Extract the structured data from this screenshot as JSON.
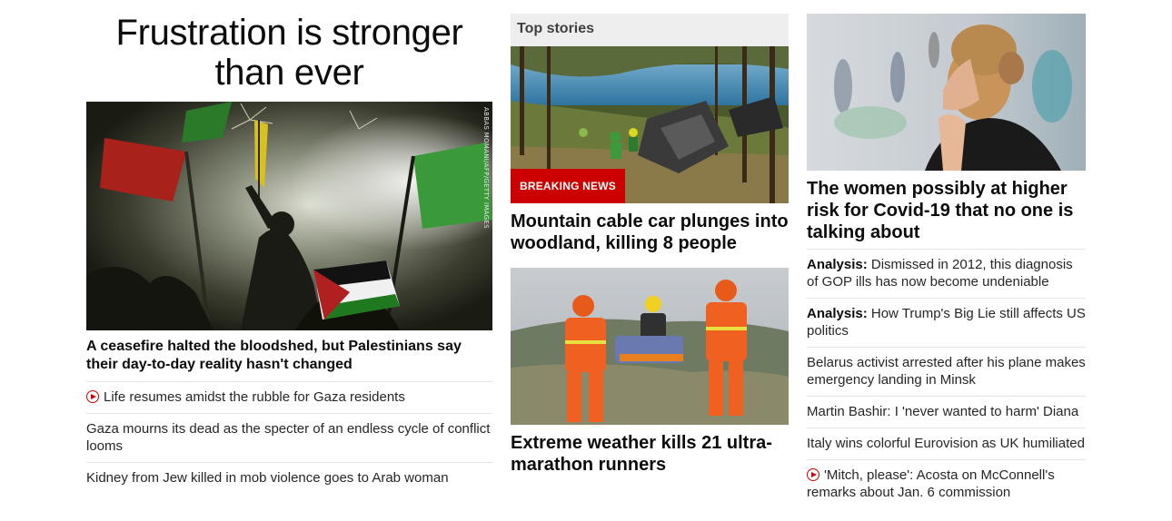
{
  "left": {
    "title": "Frustration is stronger than ever",
    "image_credit": "ABBAS MOMANI/AFP/GETTY IMAGES",
    "headline": "A ceasefire halted the bloodshed, but Palestinians say their day-to-day reality hasn't changed",
    "stories": [
      {
        "text": "Life resumes amidst the rubble for Gaza residents",
        "video": true
      },
      {
        "text": "Gaza mourns its dead as the specter of an endless cycle of conflict looms",
        "video": false
      },
      {
        "text": "Kidney from Jew killed in mob violence goes to Arab woman",
        "video": false
      }
    ]
  },
  "middle": {
    "section_title": "Top stories",
    "breaking_label": "BREAKING NEWS",
    "story1_headline": "Mountain cable car plunges into woodland, killing 8 people",
    "story2_headline": "Extreme weather kills 21 ultra-marathon runners"
  },
  "right": {
    "headline": "The women possibly at higher risk for Covid-19 that no one is talking about",
    "stories": [
      {
        "lead": "Analysis:",
        "text": "Dismissed in 2012, this diagnosis of GOP ills has now become undeniable"
      },
      {
        "lead": "Analysis:",
        "text": "How Trump's Big Lie still affects US politics"
      },
      {
        "lead": "",
        "text": "Belarus activist arrested after his plane makes emergency landing in Minsk"
      },
      {
        "lead": "",
        "text": "Martin Bashir: I 'never wanted to harm' Diana"
      },
      {
        "lead": "",
        "text": "Italy wins colorful Eurovision as UK humiliated"
      },
      {
        "lead": "",
        "text": "'Mitch, please': Acosta on McConnell's remarks about Jan. 6 commission",
        "video": true
      }
    ]
  },
  "colors": {
    "accent_red": "#cc0000",
    "text_dark": "#0c0c0c",
    "divider": "#e6e6e6",
    "section_bg": "#eeeeee"
  },
  "icons": {
    "video": "play-circle-icon"
  }
}
